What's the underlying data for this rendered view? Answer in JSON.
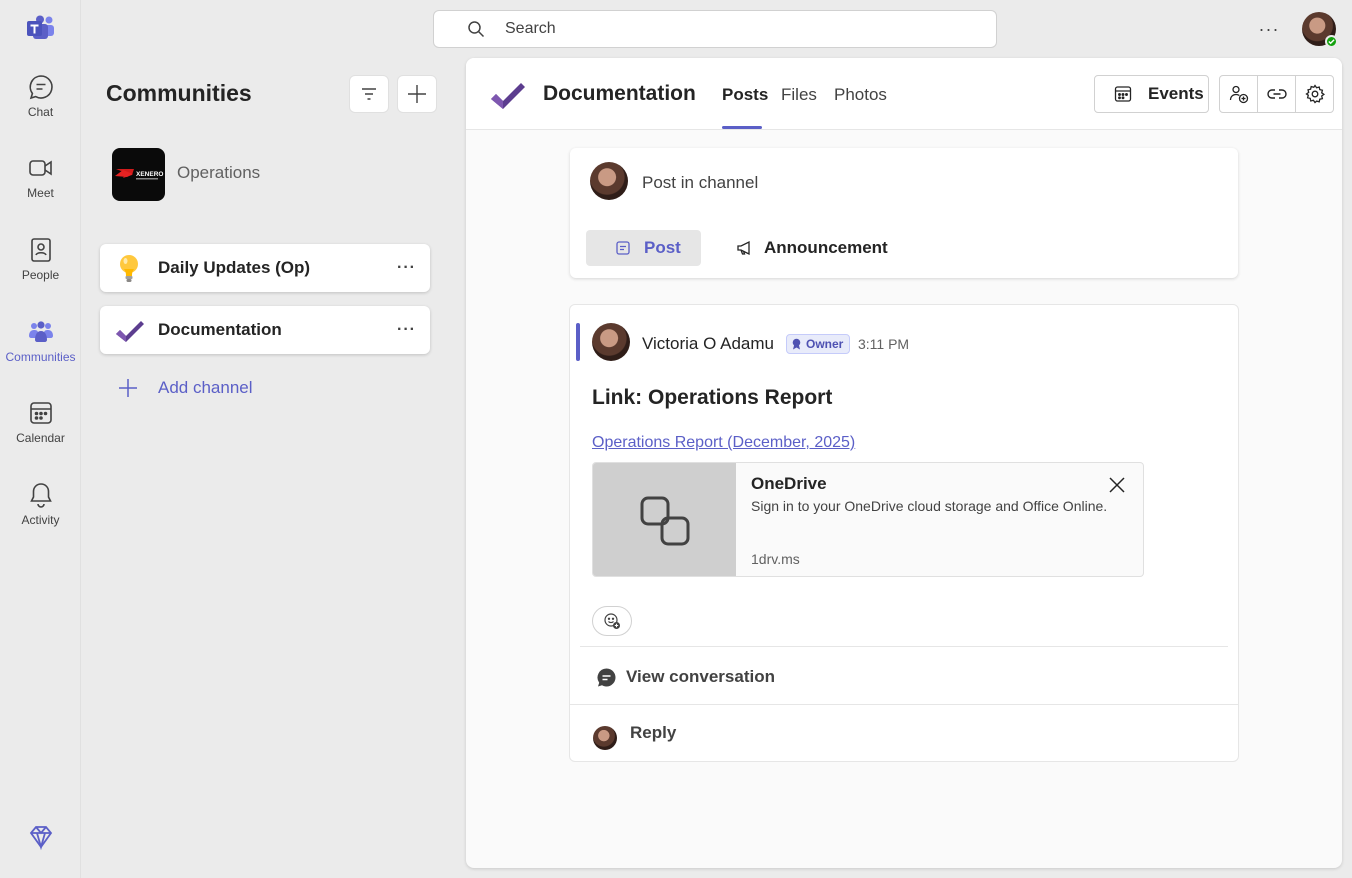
{
  "rail": {
    "items": [
      {
        "label": "Chat"
      },
      {
        "label": "Meet"
      },
      {
        "label": "People"
      },
      {
        "label": "Communities"
      },
      {
        "label": "Calendar"
      },
      {
        "label": "Activity"
      }
    ],
    "active": "Communities",
    "accent_color": "#5b5fc7"
  },
  "top_bar": {
    "search_placeholder": "Search",
    "more_label": "···",
    "presence_status": "available"
  },
  "communities": {
    "title": "Communities",
    "team": {
      "name": "Operations",
      "logo_text": "XENERO"
    },
    "channels": [
      {
        "name": "Daily Updates (Op)",
        "icon": "lightbulb-icon",
        "more": "···"
      },
      {
        "name": "Documentation",
        "icon": "checkmark-icon",
        "more": "···"
      }
    ],
    "add_channel_label": "Add channel"
  },
  "main": {
    "channel_title": "Documentation",
    "tabs": [
      {
        "label": "Posts",
        "active": true
      },
      {
        "label": "Files",
        "active": false
      },
      {
        "label": "Photos",
        "active": false
      }
    ],
    "events_label": "Events",
    "composer": {
      "placeholder": "Post in channel",
      "post_label": "Post",
      "announcement_label": "Announcement"
    },
    "post": {
      "author": "Victoria O Adamu",
      "badge": "Owner",
      "time": "3:11 PM",
      "subject": "Link: Operations Report",
      "link_text": "Operations Report (December, 2025)",
      "preview": {
        "title": "OneDrive",
        "description": "Sign in to your OneDrive cloud storage and Office Online.",
        "domain": "1drv.ms"
      },
      "view_conversation_label": "View conversation",
      "reply_label": "Reply"
    }
  }
}
